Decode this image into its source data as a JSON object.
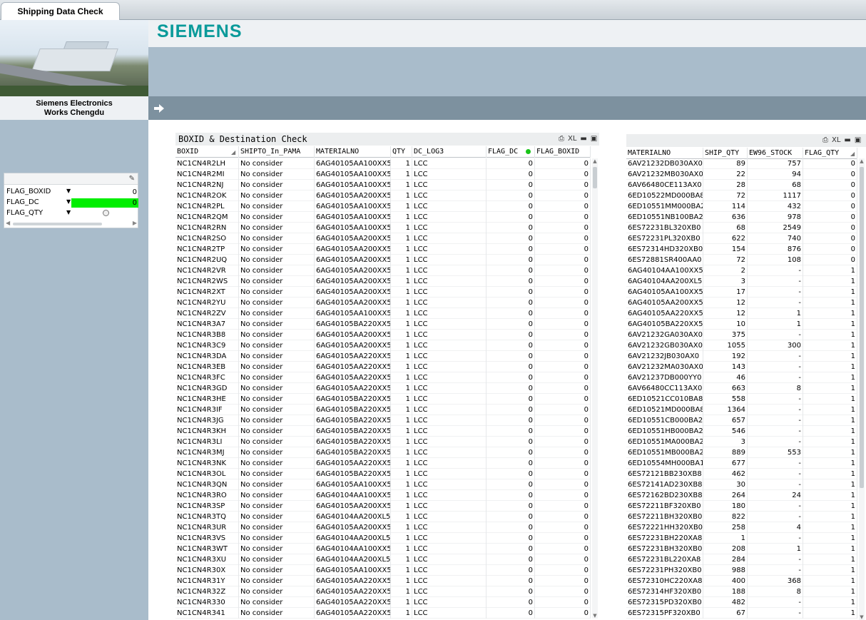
{
  "tabs": [
    {
      "label": "Shipping Data Check"
    }
  ],
  "header": {
    "logo_text": "SIEMENS",
    "company_line1": "Siemens Electronics",
    "company_line2": "Works Chengdu",
    "brand_color": "#0a9a9a"
  },
  "flag_box": {
    "items": [
      {
        "label": "FLAG_BOXID",
        "value": "0"
      },
      {
        "label": "FLAG_DC",
        "value": "0"
      },
      {
        "label": "FLAG_QTY",
        "value": ""
      }
    ],
    "highlight_color": "#00ee00"
  },
  "boxid_table": {
    "title": "BOXID & Destination Check",
    "tools": [
      "print-icon",
      "excel-icon",
      "minimize-icon",
      "maximize-icon"
    ],
    "tool_labels": [
      "XL"
    ],
    "columns": [
      "BOXID",
      "SHIPTO_In_PAMA",
      "MATERIALNO",
      "QTY",
      "DC_LOG3",
      "FLAG_DC",
      "FLAG_BOXID"
    ],
    "rows": [
      [
        "NC1CN4R2LH",
        "No consider",
        "6AG40105AA100XX5",
        "1",
        "LCC",
        "0",
        "0"
      ],
      [
        "NC1CN4R2MI",
        "No consider",
        "6AG40105AA100XX5",
        "1",
        "LCC",
        "0",
        "0"
      ],
      [
        "NC1CN4R2NJ",
        "No consider",
        "6AG40105AA100XX5",
        "1",
        "LCC",
        "0",
        "0"
      ],
      [
        "NC1CN4R2OK",
        "No consider",
        "6AG40105AA200XX5",
        "1",
        "LCC",
        "0",
        "0"
      ],
      [
        "NC1CN4R2PL",
        "No consider",
        "6AG40105AA100XX5",
        "1",
        "LCC",
        "0",
        "0"
      ],
      [
        "NC1CN4R2QM",
        "No consider",
        "6AG40105AA100XX5",
        "1",
        "LCC",
        "0",
        "0"
      ],
      [
        "NC1CN4R2RN",
        "No consider",
        "6AG40105AA100XX5",
        "1",
        "LCC",
        "0",
        "0"
      ],
      [
        "NC1CN4R2SO",
        "No consider",
        "6AG40105AA200XX5",
        "1",
        "LCC",
        "0",
        "0"
      ],
      [
        "NC1CN4R2TP",
        "No consider",
        "6AG40105AA200XX5",
        "1",
        "LCC",
        "0",
        "0"
      ],
      [
        "NC1CN4R2UQ",
        "No consider",
        "6AG40105AA200XX5",
        "1",
        "LCC",
        "0",
        "0"
      ],
      [
        "NC1CN4R2VR",
        "No consider",
        "6AG40105AA200XX5",
        "1",
        "LCC",
        "0",
        "0"
      ],
      [
        "NC1CN4R2WS",
        "No consider",
        "6AG40105AA200XX5",
        "1",
        "LCC",
        "0",
        "0"
      ],
      [
        "NC1CN4R2XT",
        "No consider",
        "6AG40105AA200XX5",
        "1",
        "LCC",
        "0",
        "0"
      ],
      [
        "NC1CN4R2YU",
        "No consider",
        "6AG40105AA200XX5",
        "1",
        "LCC",
        "0",
        "0"
      ],
      [
        "NC1CN4R2ZV",
        "No consider",
        "6AG40105AA100XX5",
        "1",
        "LCC",
        "0",
        "0"
      ],
      [
        "NC1CN4R3A7",
        "No consider",
        "6AG40105BA220XX5",
        "1",
        "LCC",
        "0",
        "0"
      ],
      [
        "NC1CN4R3B8",
        "No consider",
        "6AG40105AA200XX5",
        "1",
        "LCC",
        "0",
        "0"
      ],
      [
        "NC1CN4R3C9",
        "No consider",
        "6AG40105AA200XX5",
        "1",
        "LCC",
        "0",
        "0"
      ],
      [
        "NC1CN4R3DA",
        "No consider",
        "6AG40105AA220XX5",
        "1",
        "LCC",
        "0",
        "0"
      ],
      [
        "NC1CN4R3EB",
        "No consider",
        "6AG40105AA220XX5",
        "1",
        "LCC",
        "0",
        "0"
      ],
      [
        "NC1CN4R3FC",
        "No consider",
        "6AG40105AA220XX5",
        "1",
        "LCC",
        "0",
        "0"
      ],
      [
        "NC1CN4R3GD",
        "No consider",
        "6AG40105AA220XX5",
        "1",
        "LCC",
        "0",
        "0"
      ],
      [
        "NC1CN4R3HE",
        "No consider",
        "6AG40105BA220XX5",
        "1",
        "LCC",
        "0",
        "0"
      ],
      [
        "NC1CN4R3IF",
        "No consider",
        "6AG40105BA220XX5",
        "1",
        "LCC",
        "0",
        "0"
      ],
      [
        "NC1CN4R3JG",
        "No consider",
        "6AG40105BA220XX5",
        "1",
        "LCC",
        "0",
        "0"
      ],
      [
        "NC1CN4R3KH",
        "No consider",
        "6AG40105BA220XX5",
        "1",
        "LCC",
        "0",
        "0"
      ],
      [
        "NC1CN4R3LI",
        "No consider",
        "6AG40105BA220XX5",
        "1",
        "LCC",
        "0",
        "0"
      ],
      [
        "NC1CN4R3MJ",
        "No consider",
        "6AG40105BA220XX5",
        "1",
        "LCC",
        "0",
        "0"
      ],
      [
        "NC1CN4R3NK",
        "No consider",
        "6AG40105AA220XX5",
        "1",
        "LCC",
        "0",
        "0"
      ],
      [
        "NC1CN4R3OL",
        "No consider",
        "6AG40105BA220XX5",
        "1",
        "LCC",
        "0",
        "0"
      ],
      [
        "NC1CN4R3QN",
        "No consider",
        "6AG40105AA100XX5",
        "1",
        "LCC",
        "0",
        "0"
      ],
      [
        "NC1CN4R3RO",
        "No consider",
        "6AG40104AA100XX5",
        "1",
        "LCC",
        "0",
        "0"
      ],
      [
        "NC1CN4R3SP",
        "No consider",
        "6AG40105AA200XX5",
        "1",
        "LCC",
        "0",
        "0"
      ],
      [
        "NC1CN4R3TQ",
        "No consider",
        "6AG40104AA200XL5",
        "1",
        "LCC",
        "0",
        "0"
      ],
      [
        "NC1CN4R3UR",
        "No consider",
        "6AG40105AA200XX5",
        "1",
        "LCC",
        "0",
        "0"
      ],
      [
        "NC1CN4R3VS",
        "No consider",
        "6AG40104AA200XL5",
        "1",
        "LCC",
        "0",
        "0"
      ],
      [
        "NC1CN4R3WT",
        "No consider",
        "6AG40104AA100XX5",
        "1",
        "LCC",
        "0",
        "0"
      ],
      [
        "NC1CN4R3XU",
        "No consider",
        "6AG40104AA200XL5",
        "1",
        "LCC",
        "0",
        "0"
      ],
      [
        "NC1CN4R30X",
        "No consider",
        "6AG40105AA100XX5",
        "1",
        "LCC",
        "0",
        "0"
      ],
      [
        "NC1CN4R31Y",
        "No consider",
        "6AG40105AA220XX5",
        "1",
        "LCC",
        "0",
        "0"
      ],
      [
        "NC1CN4R32Z",
        "No consider",
        "6AG40105AA220XX5",
        "1",
        "LCC",
        "0",
        "0"
      ],
      [
        "NC1CN4R330",
        "No consider",
        "6AG40105AA220XX5",
        "1",
        "LCC",
        "0",
        "0"
      ],
      [
        "NC1CN4R341",
        "No consider",
        "6AG40105AA220XX5",
        "1",
        "LCC",
        "0",
        "0"
      ]
    ]
  },
  "qty_table": {
    "tools": [
      "print-icon",
      "excel-icon",
      "minimize-icon",
      "maximize-icon"
    ],
    "tool_labels": [
      "XL"
    ],
    "columns": [
      "MATERIALNO",
      "SHIP_QTY",
      "EW96_STOCK",
      "FLAG_QTY"
    ],
    "rows": [
      [
        "6AV21232DB030AX0",
        "89",
        "757",
        "0"
      ],
      [
        "6AV21232MB030AX0",
        "22",
        "94",
        "0"
      ],
      [
        "6AV66480CE113AX0",
        "28",
        "68",
        "0"
      ],
      [
        "6ED10522MD000BA8",
        "72",
        "1117",
        "0"
      ],
      [
        "6ED10551MM000BA2",
        "114",
        "432",
        "0"
      ],
      [
        "6ED10551NB100BA2",
        "636",
        "978",
        "0"
      ],
      [
        "6ES72231BL320XB0",
        "68",
        "2549",
        "0"
      ],
      [
        "6ES72231PL320XB0",
        "622",
        "740",
        "0"
      ],
      [
        "6ES72314HD320XB0",
        "154",
        "876",
        "0"
      ],
      [
        "6ES72881SR400AA0",
        "72",
        "108",
        "0"
      ],
      [
        "6AG40104AA100XX5",
        "2",
        "-",
        "1"
      ],
      [
        "6AG40104AA200XL5",
        "3",
        "-",
        "1"
      ],
      [
        "6AG40105AA100XX5",
        "17",
        "-",
        "1"
      ],
      [
        "6AG40105AA200XX5",
        "12",
        "-",
        "1"
      ],
      [
        "6AG40105AA220XX5",
        "12",
        "1",
        "1"
      ],
      [
        "6AG40105BA220XX5",
        "10",
        "1",
        "1"
      ],
      [
        "6AV21232GA030AX0",
        "375",
        "-",
        "1"
      ],
      [
        "6AV21232GB030AX0",
        "1055",
        "300",
        "1"
      ],
      [
        "6AV21232JB030AX0",
        "192",
        "-",
        "1"
      ],
      [
        "6AV21232MA030AX0",
        "143",
        "-",
        "1"
      ],
      [
        "6AV21237DB000YY0",
        "46",
        "-",
        "1"
      ],
      [
        "6AV66480CC113AX0",
        "663",
        "8",
        "1"
      ],
      [
        "6ED10521CC010BA8",
        "558",
        "-",
        "1"
      ],
      [
        "6ED10521MD000BA8",
        "1364",
        "-",
        "1"
      ],
      [
        "6ED10551CB000BA2",
        "657",
        "-",
        "1"
      ],
      [
        "6ED10551HB000BA2",
        "546",
        "-",
        "1"
      ],
      [
        "6ED10551MA000BA2",
        "3",
        "-",
        "1"
      ],
      [
        "6ED10551MB000BA2",
        "889",
        "553",
        "1"
      ],
      [
        "6ED10554MH000BA1",
        "677",
        "-",
        "1"
      ],
      [
        "6ES72121BB230XB8",
        "462",
        "-",
        "1"
      ],
      [
        "6ES72141AD230XB8",
        "30",
        "-",
        "1"
      ],
      [
        "6ES72162BD230XB8",
        "264",
        "24",
        "1"
      ],
      [
        "6ES72211BF320XB0",
        "180",
        "-",
        "1"
      ],
      [
        "6ES72211BH320XB0",
        "822",
        "-",
        "1"
      ],
      [
        "6ES72221HH320XB0",
        "258",
        "4",
        "1"
      ],
      [
        "6ES72231BH220XA8",
        "1",
        "-",
        "1"
      ],
      [
        "6ES72231BH320XB0",
        "208",
        "1",
        "1"
      ],
      [
        "6ES72231BL220XA8",
        "284",
        "-",
        "1"
      ],
      [
        "6ES72231PH320XB0",
        "988",
        "-",
        "1"
      ],
      [
        "6ES72310HC220XA8",
        "400",
        "368",
        "1"
      ],
      [
        "6ES72314HF320XB0",
        "188",
        "8",
        "1"
      ],
      [
        "6ES72315PD320XB0",
        "482",
        "-",
        "1"
      ],
      [
        "6ES72315PF320XB0",
        "67",
        "-",
        "1"
      ]
    ]
  }
}
